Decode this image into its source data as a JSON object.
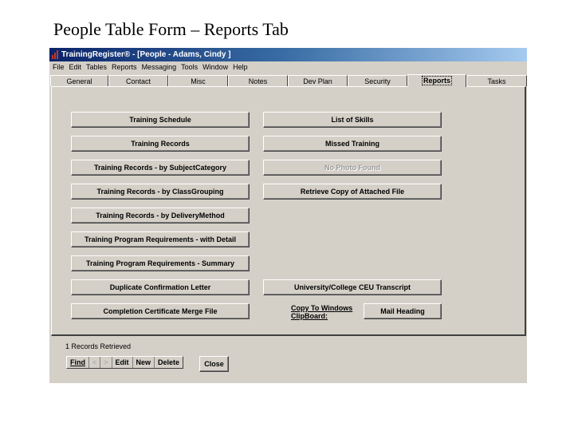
{
  "slide_title": "People Table Form – Reports Tab",
  "window": {
    "title": "TrainingRegister® - [People - Adams, Cindy ]",
    "menu": [
      "File",
      "Edit",
      "Tables",
      "Reports",
      "Messaging",
      "Tools",
      "Window",
      "Help"
    ],
    "tabs": [
      {
        "label": "General"
      },
      {
        "label": "Contact"
      },
      {
        "label": "Misc"
      },
      {
        "label": "Notes"
      },
      {
        "label": "Dev Plan"
      },
      {
        "label": "Security"
      },
      {
        "label": "Reports",
        "active": true
      },
      {
        "label": "Tasks"
      }
    ]
  },
  "reports": {
    "left": [
      "Training Schedule",
      "Training Records",
      "Training Records - by SubjectCategory",
      "Training Records - by ClassGrouping",
      "Training Records - by DeliveryMethod",
      "Training Program Requirements - with Detail",
      "Training Program Requirements - Summary",
      "Duplicate Confirmation Letter",
      "Completion Certificate Merge File"
    ],
    "right": [
      "List of Skills",
      "Missed Training",
      "No Photo Found",
      "Retrieve Copy of Attached File",
      "University/College CEU Transcript"
    ],
    "clipboard_label_line1": "Copy To Windows",
    "clipboard_label_line2": "ClipBoard:",
    "mail_heading": "Mail Heading"
  },
  "footer": {
    "status": "1 Records Retrieved",
    "nav": [
      "Find",
      "<",
      ">",
      "Edit",
      "New",
      "Delete"
    ],
    "close": "Close"
  }
}
